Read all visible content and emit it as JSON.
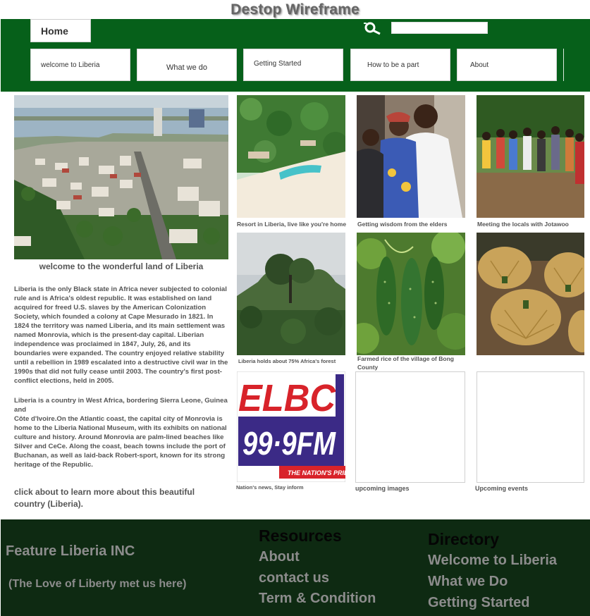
{
  "page_title": "Destop Wireframe",
  "header": {
    "home_label": "Home",
    "search_placeholder": "",
    "nav": [
      "welcome to Liberia",
      "What we do",
      "Getting Started",
      "How to be a part",
      "About"
    ]
  },
  "hero": {
    "image": "monrovia-cityscape-image",
    "caption": "welcome to the wonderful land of Liberia"
  },
  "intro": {
    "paragraph1": "Liberia is the only Black state in Africa never subjected to colonial rule and is Africa's oldest republic.  It was established on land acquired for freed U.S. slaves by the American Colonization Society,  which founded a colony at Cape Mesurado in 1821. In 1824 the territory was named Liberia, and its main settlement was named Monrovia, which is the present-day capital. Liberian independence was proclaimed in 1847, July, 26, and its boundaries were expanded. The country enjoyed relative stability until a rebellion in 1989 escalated into a destructive civil war in the 1990s that  did not fully cease until 2003. The country's first post-conflict elections, held in 2005.",
    "paragraph2": "Liberia is a country in West Africa, bordering Sierra Leone, Guinea and\nCôte d'Ivoire.On the Atlantic coast, the capital city of Monrovia is home to the Liberia National Museum, with its exhibits on national culture and history. Around Monrovia are palm-lined beaches like Silver and CeCe. Along the coast, beach towns include the port of Buchanan, as well as laid-back Robert-sport, known for its strong heritage of the Republic.",
    "cta": "click about to learn more about this beautiful country (Liberia)."
  },
  "gallery": [
    {
      "image": "beach-resort-image",
      "caption": "Resort in Liberia, live like you're home"
    },
    {
      "image": "elders-photo-image",
      "caption": "Getting wisdom from the elders"
    },
    {
      "image": "locals-group-image",
      "caption": "Meeting the locals with Jotawoo"
    },
    {
      "image": "rainforest-image",
      "caption": "Liberia holds about 75% Africa's forest"
    },
    {
      "image": "cucumbers-image",
      "caption": "Farmed rice of the village of Bong County"
    },
    {
      "image": "rice-bundles-image",
      "caption": ""
    },
    {
      "image": "elbc-logo-image",
      "caption": "Nation's news, Stay inform",
      "logo_top": "ELBC",
      "logo_freq": "99·9FM",
      "logo_tag": "THE NATION'S PRIDE"
    },
    {
      "image": "",
      "caption": "upcoming images"
    },
    {
      "image": "",
      "caption": "Upcoming events"
    }
  ],
  "footer": {
    "brand": "Feature Liberia INC",
    "tagline": "(The Love of Liberty met us here)",
    "resources_heading": "Resources",
    "resources": [
      "About",
      "contact us",
      "Term & Condition"
    ],
    "directory_heading": "Directory",
    "directory": [
      "Welcome to Liberia",
      "What we Do",
      "Getting Started"
    ]
  },
  "colors": {
    "header_bg": "#06601a",
    "footer_bg": "#0e2a12",
    "elbc_red": "#d8232a",
    "elbc_purple": "#3b2a86"
  }
}
